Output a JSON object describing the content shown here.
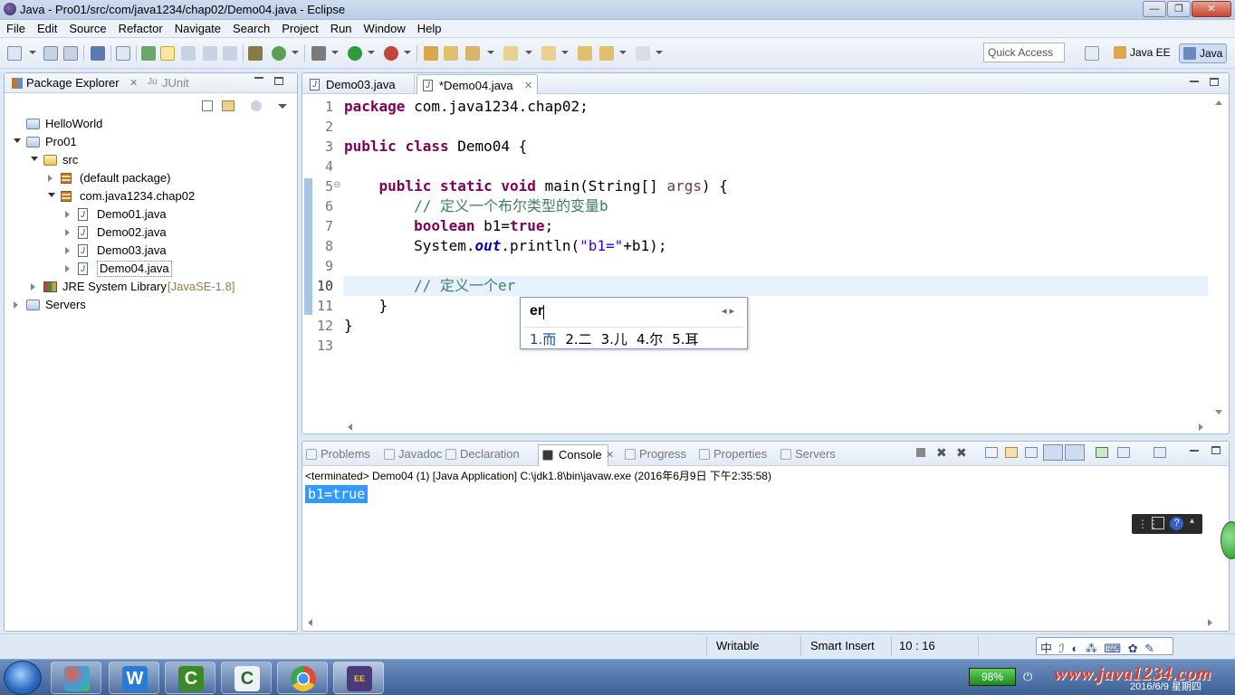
{
  "window": {
    "title": "Java - Pro01/src/com/java1234/chap02/Demo04.java - Eclipse"
  },
  "menubar": [
    "File",
    "Edit",
    "Source",
    "Refactor",
    "Navigate",
    "Search",
    "Project",
    "Run",
    "Window",
    "Help"
  ],
  "toolbar": {
    "quick_access_placeholder": "Quick Access",
    "perspectives": [
      {
        "label": "Java EE",
        "icon": "java-ee-perspective-icon",
        "active": false
      },
      {
        "label": "Java",
        "icon": "java-perspective-icon",
        "active": true
      }
    ]
  },
  "package_explorer": {
    "tabs": [
      "Package Explorer",
      "JUnit"
    ],
    "tree": [
      {
        "label": "HelloWorld",
        "depth": 0,
        "icon": "project-folder-icon",
        "twisty": "none"
      },
      {
        "label": "Pro01",
        "depth": 0,
        "icon": "project-folder-icon",
        "twisty": "open"
      },
      {
        "label": "src",
        "depth": 1,
        "icon": "source-folder-icon",
        "twisty": "open"
      },
      {
        "label": "(default package)",
        "depth": 2,
        "icon": "package-icon",
        "twisty": "closed"
      },
      {
        "label": "com.java1234.chap02",
        "depth": 2,
        "icon": "package-icon",
        "twisty": "open"
      },
      {
        "label": "Demo01.java",
        "depth": 3,
        "icon": "java-file-icon",
        "twisty": "closed"
      },
      {
        "label": "Demo02.java",
        "depth": 3,
        "icon": "java-file-icon",
        "twisty": "closed"
      },
      {
        "label": "Demo03.java",
        "depth": 3,
        "icon": "java-file-icon",
        "twisty": "closed"
      },
      {
        "label": "Demo04.java",
        "depth": 3,
        "icon": "java-file-icon",
        "twisty": "closed",
        "selected": true
      },
      {
        "label": "JRE System Library",
        "suffix": "[JavaSE-1.8]",
        "depth": 1,
        "icon": "library-icon",
        "twisty": "closed"
      },
      {
        "label": "Servers",
        "depth": 0,
        "icon": "project-folder-icon",
        "twisty": "closed"
      }
    ]
  },
  "editor": {
    "tabs": [
      {
        "label": "Demo03.java",
        "active": false
      },
      {
        "label": "*Demo04.java",
        "active": true
      }
    ],
    "current_line": 10,
    "lines": [
      {
        "n": "1",
        "parts": [
          [
            "kw",
            "package"
          ],
          [
            "",
            " com.java1234.chap02;"
          ]
        ]
      },
      {
        "n": "2",
        "parts": []
      },
      {
        "n": "3",
        "parts": [
          [
            "kw",
            "public"
          ],
          [
            "",
            " "
          ],
          [
            "kw",
            "class"
          ],
          [
            "",
            " Demo04 {"
          ]
        ]
      },
      {
        "n": "4",
        "parts": []
      },
      {
        "n": "5",
        "parts": [
          [
            "",
            "    "
          ],
          [
            "kw",
            "public"
          ],
          [
            "",
            " "
          ],
          [
            "kw",
            "static"
          ],
          [
            "",
            " "
          ],
          [
            "kw",
            "void"
          ],
          [
            "",
            " main(String[] "
          ],
          [
            "pm",
            "args"
          ],
          [
            "",
            ") {"
          ]
        ]
      },
      {
        "n": "6",
        "parts": [
          [
            "",
            "        "
          ],
          [
            "cm",
            "// 定义一个布尔类型的变量b"
          ]
        ]
      },
      {
        "n": "7",
        "parts": [
          [
            "",
            "        "
          ],
          [
            "kw",
            "boolean"
          ],
          [
            "",
            " b1="
          ],
          [
            "kw",
            "true"
          ],
          [
            "",
            ";"
          ]
        ]
      },
      {
        "n": "8",
        "parts": [
          [
            "",
            "        System."
          ],
          [
            "it",
            "out"
          ],
          [
            "",
            ".println("
          ],
          [
            "st",
            "\"b1=\""
          ],
          [
            "",
            "+b1);"
          ]
        ]
      },
      {
        "n": "9",
        "parts": []
      },
      {
        "n": "10",
        "parts": [
          [
            "",
            "        "
          ],
          [
            "cm",
            "// 定义一个er"
          ]
        ]
      },
      {
        "n": "11",
        "parts": [
          [
            "",
            "    }"
          ]
        ]
      },
      {
        "n": "12",
        "parts": [
          [
            "",
            "}"
          ]
        ]
      },
      {
        "n": "13",
        "parts": []
      }
    ]
  },
  "ime_popup": {
    "input": "er",
    "candidates": [
      "1.而",
      "2.二",
      "3.儿",
      "4.尔",
      "5.耳"
    ]
  },
  "bottom_panel": {
    "tabs": [
      {
        "label": "Problems",
        "active": false
      },
      {
        "label": "Javadoc",
        "active": false
      },
      {
        "label": "Declaration",
        "active": false
      },
      {
        "label": "Console",
        "active": true
      },
      {
        "label": "Progress",
        "active": false
      },
      {
        "label": "Properties",
        "active": false
      },
      {
        "label": "Servers",
        "active": false
      }
    ],
    "console_status": "<terminated> Demo04 (1) [Java Application] C:\\jdk1.8\\bin\\javaw.exe (2016年6月9日 下午2:35:58)",
    "console_output": "b1=true"
  },
  "statusbar": {
    "writable": "Writable",
    "insert_mode": "Smart Insert",
    "position": "10 : 16",
    "ime_tray": "中 ℐ ◐ ⁂ ⌨ ✿ ✎"
  },
  "taskbar": {
    "battery": "98%",
    "watermark": "www.java1234.com",
    "date": "2016/6/9 星期四"
  },
  "colors": {
    "keyword": "#7f0055",
    "comment": "#3f7f5f",
    "string": "#2a00ff",
    "field": "#0000c0",
    "selection": "#3399ff"
  }
}
